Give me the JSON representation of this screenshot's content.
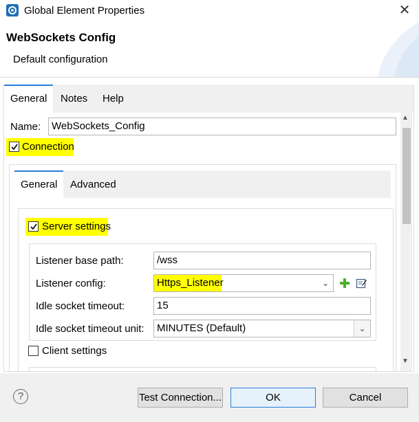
{
  "window": {
    "title": "Global Element Properties",
    "close_glyph": "✕"
  },
  "header": {
    "title": "WebSockets Config",
    "subtitle": "Default configuration"
  },
  "outer_tabs": [
    {
      "label": "General",
      "active": true
    },
    {
      "label": "Notes"
    },
    {
      "label": "Help"
    }
  ],
  "name": {
    "label": "Name:",
    "value": "WebSockets_Config"
  },
  "connection": {
    "label": "Connection",
    "checked": true,
    "highlight": "#ffff00"
  },
  "inner_tabs": [
    {
      "label": "General",
      "active": true
    },
    {
      "label": "Advanced"
    }
  ],
  "server_settings": {
    "label": "Server settings",
    "checked": true,
    "fields": {
      "listener_base_path": {
        "label": "Listener base path:",
        "value": "/wss"
      },
      "listener_config": {
        "label": "Listener config:",
        "value": "Https_Listener"
      },
      "idle_socket_timeout": {
        "label": "Idle socket timeout:",
        "value": "15"
      },
      "idle_socket_timeout_unit": {
        "label": "Idle socket timeout unit:",
        "value": "MINUTES (Default)"
      }
    }
  },
  "client_settings": {
    "label": "Client settings",
    "checked": false
  },
  "footer": {
    "help_glyph": "?",
    "test_connection_label": "Test Connection...",
    "ok_label": "OK",
    "cancel_label": "Cancel"
  },
  "icons": {
    "add": "plus-icon",
    "edit": "edit-icon",
    "app": "mule-app-icon"
  },
  "colors": {
    "accent": "#2a7bd6",
    "add_icon": "#4caf2a",
    "highlight": "#ffff00"
  }
}
